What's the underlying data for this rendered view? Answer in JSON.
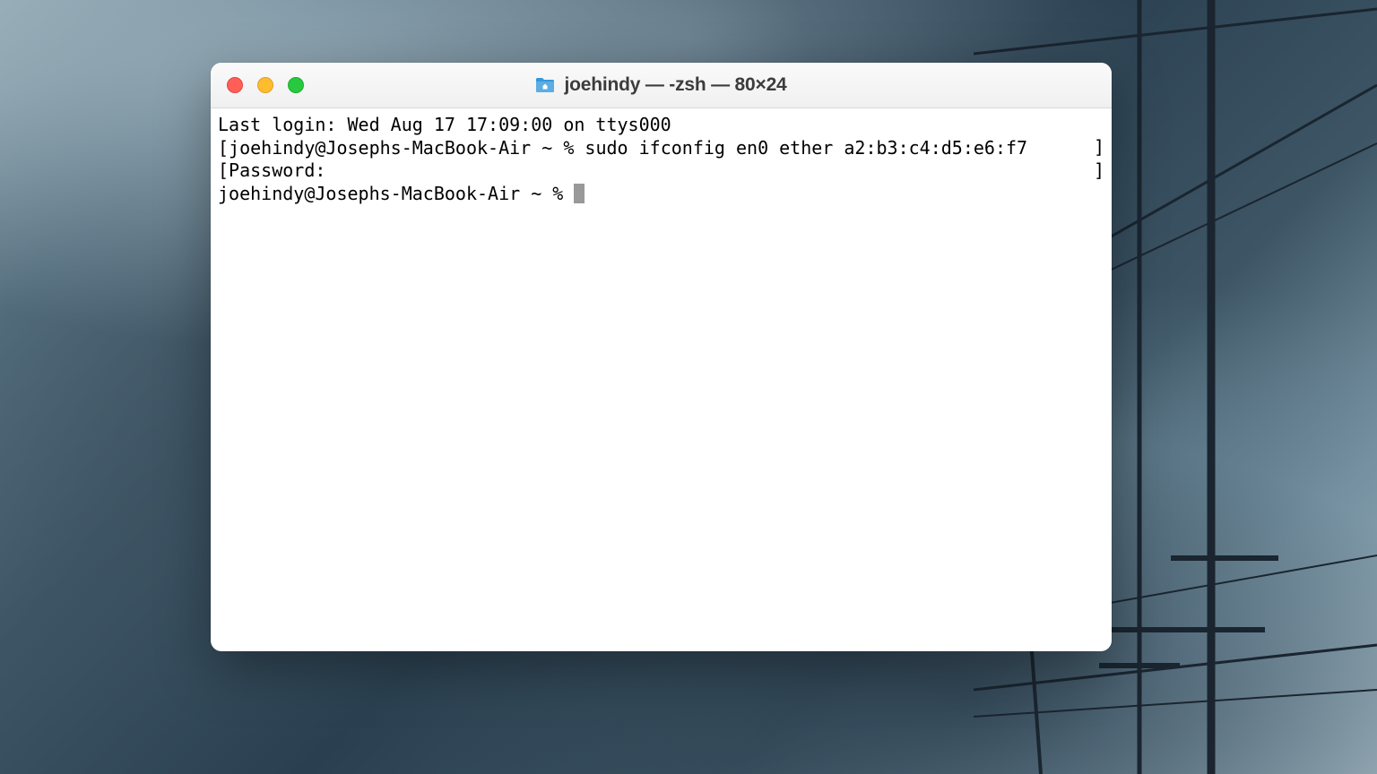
{
  "window": {
    "title": "joehindy — -zsh — 80×24"
  },
  "terminal": {
    "line1": "Last login: Wed Aug 17 17:09:00 on ttys000",
    "line2_open": "[",
    "line2_prompt": "joehindy@Josephs-MacBook-Air ~ % ",
    "line2_command": "sudo ifconfig en0 ether a2:b3:c4:d5:e6:f7",
    "line2_close": "]",
    "line3_open": "[",
    "line3_text": "Password:",
    "line3_close": "]",
    "line4_prompt": "joehindy@Josephs-MacBook-Air ~ % "
  }
}
